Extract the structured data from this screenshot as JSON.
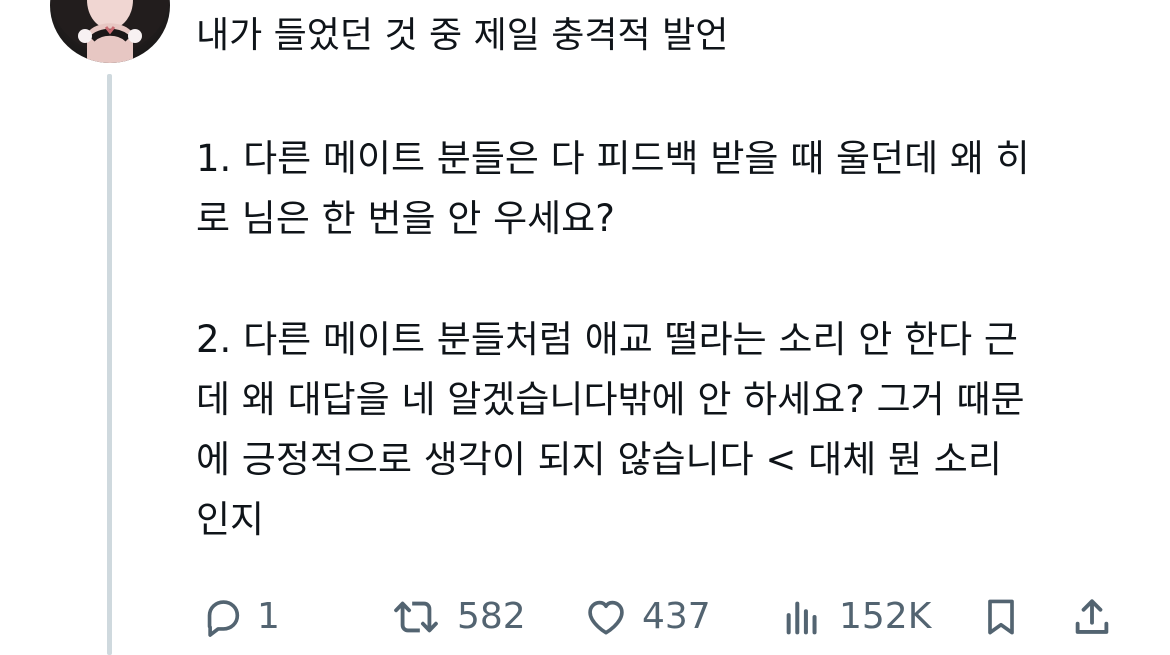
{
  "post": {
    "title": "내가 들었던 것 중 제일 충격적 발언",
    "paragraph1": {
      "line1": "1. 다른 메이트 분들은 다 피드백 받을 때 울던데 왜 히",
      "line2": "로 님은 한 번을 안 우세요?"
    },
    "paragraph2": {
      "line1": "2. 다른 메이트 분들처럼 애교 떨라는 소리 안 한다 근",
      "line2": "데 왜 대답을 네 알겠습니다밖에 안 하세요? 그거 때문",
      "line3": "에 긍정적으로 생각이 되지 않습니다 < 대체 뭔 소리",
      "line4": "인지"
    }
  },
  "actions": {
    "reply_count": "1",
    "repost_count": "582",
    "like_count": "437",
    "views_count": "152K"
  },
  "icons": {
    "reply": "reply-icon",
    "repost": "repost-icon",
    "like": "heart-icon",
    "views": "views-chart-icon",
    "bookmark": "bookmark-icon",
    "share": "share-icon"
  },
  "colors": {
    "text": "#0f1419",
    "muted": "#536471",
    "thread_line": "#cfd9de",
    "background": "#ffffff"
  }
}
